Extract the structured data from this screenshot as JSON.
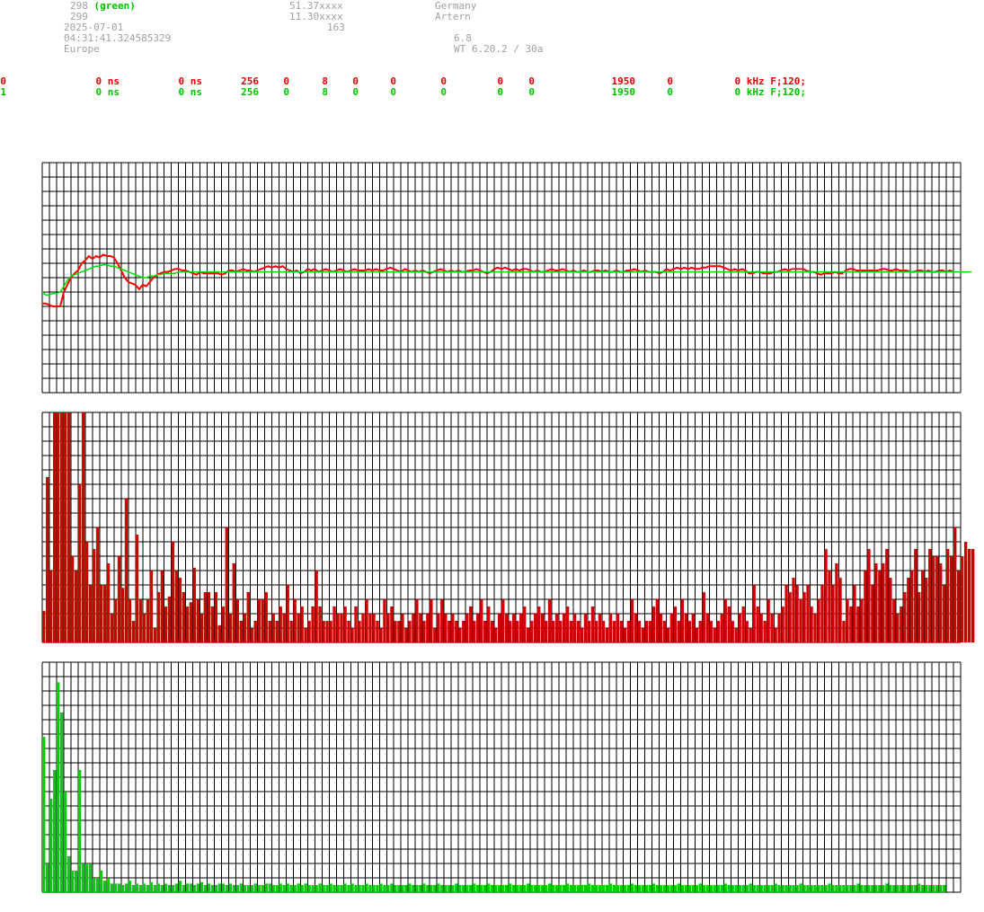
{
  "header": {
    "col1": {
      "line1_num": "298",
      "line1_tag": "(green)",
      "line2": "299",
      "date": "2025-07-01",
      "time": "04:31:41.324585329",
      "region": "Europe"
    },
    "col2": {
      "lat": "51.37xxxx",
      "lon": "11.30xxxx",
      "alt": "163"
    },
    "col3": {
      "country": "Germany",
      "city": "Artern",
      "value": "6.8",
      "version": "WT 6.20.2 / 30a"
    }
  },
  "status_rows": [
    {
      "color": "#e00000",
      "cells": [
        "0",
        "0 ns",
        "0 ns",
        "256",
        "0",
        "8",
        "0",
        "0",
        "0",
        "0",
        "0",
        "1950",
        "0",
        "0 kHz F;120;"
      ]
    },
    {
      "color": "#00c000",
      "cells": [
        "1",
        "0 ns",
        "0 ns",
        "256",
        "0",
        "8",
        "0",
        "0",
        "0",
        "0",
        "0",
        "1950",
        "0",
        "0 kHz F;120;"
      ]
    }
  ],
  "chart_data": [
    {
      "type": "line",
      "title": "",
      "grid": true,
      "ylim": [
        -8,
        8
      ],
      "x_count": 256,
      "series": [
        {
          "color": "#ff0000",
          "values": [
            -1.8,
            -1.8,
            -1.9,
            -2.0,
            -2.0,
            -2.0,
            -1.0,
            -0.5,
            0.0,
            0.3,
            0.5,
            1.0,
            1.2,
            1.5,
            1.3,
            1.5,
            1.4,
            1.6,
            1.5,
            1.5,
            1.4,
            1.0,
            0.5,
            0.0,
            -0.3,
            -0.4,
            -0.5,
            -0.8,
            -0.5,
            -0.6,
            -0.3,
            0.0,
            0.2,
            0.3,
            0.4,
            0.4,
            0.5,
            0.6,
            0.6,
            0.5,
            0.5,
            0.4,
            0.3,
            0.2,
            0.4,
            0.3,
            0.3,
            0.3,
            0.3,
            0.3,
            0.2,
            0.3,
            0.5,
            0.5,
            0.4,
            0.5,
            0.6,
            0.5,
            0.5,
            0.4,
            0.5,
            0.6,
            0.7,
            0.8,
            0.7,
            0.8,
            0.7,
            0.8,
            0.6,
            0.5,
            0.4,
            0.5,
            0.3,
            0.4,
            0.6,
            0.5,
            0.6,
            0.4,
            0.5,
            0.6,
            0.5,
            0.4,
            0.5,
            0.6,
            0.5,
            0.4,
            0.5,
            0.6,
            0.5,
            0.5,
            0.5,
            0.6,
            0.5,
            0.6,
            0.5,
            0.5,
            0.6,
            0.7,
            0.6,
            0.5,
            0.4,
            0.6,
            0.5,
            0.4,
            0.5,
            0.4,
            0.5,
            0.4,
            0.3,
            0.4,
            0.5,
            0.6,
            0.5,
            0.4,
            0.5,
            0.4,
            0.5,
            0.4,
            0.4,
            0.5,
            0.5,
            0.6,
            0.5,
            0.4,
            0.3,
            0.4,
            0.6,
            0.7,
            0.6,
            0.7,
            0.6,
            0.5,
            0.6,
            0.5,
            0.6,
            0.6,
            0.5,
            0.4,
            0.5,
            0.4,
            0.4,
            0.5,
            0.6,
            0.5,
            0.5,
            0.6,
            0.5,
            0.4,
            0.5,
            0.4,
            0.4,
            0.5,
            0.4,
            0.4,
            0.5,
            0.5,
            0.4,
            0.5,
            0.4,
            0.4,
            0.5,
            0.4,
            0.4,
            0.5,
            0.5,
            0.6,
            0.5,
            0.4,
            0.5,
            0.4,
            0.4,
            0.4,
            0.3,
            0.4,
            0.6,
            0.5,
            0.6,
            0.7,
            0.6,
            0.7,
            0.6,
            0.7,
            0.6,
            0.6,
            0.7,
            0.7,
            0.8,
            0.8,
            0.8,
            0.8,
            0.7,
            0.6,
            0.5,
            0.6,
            0.5,
            0.6,
            0.5,
            0.3,
            0.3,
            0.4,
            0.4,
            0.3,
            0.3,
            0.3,
            0.4,
            0.4,
            0.5,
            0.6,
            0.5,
            0.6,
            0.6,
            0.6,
            0.6,
            0.5,
            0.4,
            0.4,
            0.3,
            0.2,
            0.3,
            0.3,
            0.3,
            0.4,
            0.3,
            0.3,
            0.5,
            0.6,
            0.6,
            0.5,
            0.5,
            0.5,
            0.5,
            0.5,
            0.5,
            0.5,
            0.6,
            0.6,
            0.5,
            0.5,
            0.6,
            0.5,
            0.5,
            0.5,
            0.4,
            0.4,
            0.5,
            0.5,
            0.4,
            0.5,
            0.4,
            0.4,
            0.5,
            0.5,
            0.4,
            0.5,
            0.4
          ]
        },
        {
          "color": "#00dd00",
          "values": [
            -1.0,
            -1.2,
            -1.2,
            -1.1,
            -1.1,
            -1.0,
            -0.6,
            -0.2,
            0.1,
            0.2,
            0.3,
            0.4,
            0.5,
            0.6,
            0.7,
            0.8,
            0.8,
            0.9,
            0.9,
            0.8,
            0.8,
            0.7,
            0.6,
            0.5,
            0.4,
            0.3,
            0.2,
            0.1,
            0.0,
            0.0,
            0.1,
            0.1,
            0.2,
            0.2,
            0.3,
            0.3,
            0.3,
            0.3,
            0.4,
            0.4,
            0.4,
            0.4,
            0.4,
            0.4,
            0.4,
            0.4,
            0.4,
            0.4,
            0.4,
            0.4,
            0.4,
            0.4,
            0.4,
            0.4,
            0.4,
            0.4,
            0.4,
            0.4,
            0.4,
            0.4,
            0.4,
            0.4,
            0.4,
            0.4,
            0.4,
            0.4,
            0.4,
            0.4,
            0.4,
            0.4,
            0.4,
            0.4,
            0.4,
            0.4,
            0.4,
            0.4,
            0.4,
            0.4,
            0.4,
            0.4,
            0.4,
            0.4,
            0.4,
            0.4,
            0.4,
            0.4,
            0.4,
            0.4,
            0.4,
            0.4,
            0.4,
            0.4,
            0.4,
            0.4,
            0.4,
            0.4,
            0.4,
            0.4,
            0.4,
            0.4,
            0.4,
            0.4,
            0.4,
            0.4,
            0.4,
            0.4,
            0.4,
            0.4,
            0.4,
            0.4,
            0.4,
            0.4,
            0.4,
            0.4,
            0.4,
            0.4,
            0.4,
            0.4,
            0.4,
            0.4,
            0.4,
            0.4,
            0.4,
            0.4,
            0.4,
            0.4,
            0.4,
            0.4,
            0.4,
            0.4,
            0.4,
            0.4,
            0.4,
            0.4,
            0.4,
            0.4,
            0.4,
            0.4,
            0.4,
            0.4,
            0.4,
            0.4,
            0.4,
            0.4,
            0.4,
            0.4,
            0.4,
            0.4,
            0.4,
            0.4,
            0.4,
            0.4,
            0.4,
            0.4,
            0.4,
            0.4,
            0.4,
            0.4,
            0.4,
            0.4,
            0.4,
            0.4,
            0.4,
            0.4,
            0.4,
            0.4,
            0.4,
            0.4,
            0.4,
            0.4,
            0.4,
            0.4,
            0.4,
            0.4,
            0.4,
            0.4,
            0.4,
            0.4,
            0.4,
            0.4,
            0.4,
            0.4,
            0.4,
            0.4,
            0.4,
            0.4,
            0.4,
            0.4,
            0.4,
            0.4,
            0.4,
            0.4,
            0.4,
            0.4,
            0.4,
            0.4,
            0.4,
            0.4,
            0.4,
            0.4,
            0.4,
            0.4,
            0.4,
            0.4,
            0.4,
            0.4,
            0.4,
            0.4,
            0.4,
            0.4,
            0.4,
            0.4,
            0.4,
            0.4,
            0.4,
            0.4,
            0.4,
            0.4,
            0.4,
            0.4,
            0.4,
            0.4,
            0.4,
            0.4,
            0.4,
            0.4,
            0.4,
            0.4,
            0.4,
            0.4,
            0.4,
            0.4,
            0.4,
            0.4,
            0.4,
            0.4,
            0.4,
            0.4,
            0.4,
            0.4,
            0.4,
            0.4,
            0.4,
            0.4,
            0.4,
            0.4,
            0.4,
            0.4,
            0.4,
            0.4,
            0.4,
            0.4,
            0.4,
            0.4,
            0.4,
            0.4,
            0.4,
            0.4,
            0.4,
            0.4
          ]
        }
      ]
    },
    {
      "type": "bar",
      "title": "",
      "grid": true,
      "ylim": [
        0,
        16
      ],
      "color": "#d00000",
      "values": [
        2.2,
        11.5,
        5.0,
        16.0,
        16.0,
        16.0,
        16.0,
        16.0,
        6.0,
        5.0,
        11.0,
        16.0,
        7.0,
        4.0,
        6.5,
        8.0,
        4.0,
        4.0,
        5.5,
        2.0,
        3.0,
        6.0,
        3.8,
        10.0,
        3.0,
        1.5,
        7.5,
        3.0,
        2.0,
        3.0,
        5.0,
        1.0,
        3.5,
        5.0,
        2.5,
        3.2,
        7.0,
        5.0,
        4.5,
        3.5,
        2.5,
        2.8,
        5.2,
        3.0,
        2.0,
        3.5,
        3.5,
        2.5,
        3.5,
        1.2,
        2.5,
        8.0,
        2.0,
        5.5,
        3.0,
        1.5,
        2.0,
        3.5,
        1.0,
        1.5,
        3.0,
        3.0,
        3.5,
        1.5,
        2.0,
        1.5,
        2.5,
        2.0,
        4.0,
        1.5,
        3.0,
        2.0,
        2.5,
        1.0,
        1.5,
        2.5,
        5.0,
        2.5,
        1.5,
        1.5,
        1.5,
        2.5,
        2.0,
        2.0,
        2.5,
        1.5,
        1.0,
        2.5,
        1.5,
        2.0,
        3.0,
        2.0,
        2.0,
        1.5,
        1.0,
        3.0,
        2.0,
        2.5,
        1.5,
        1.5,
        2.0,
        1.0,
        1.5,
        2.0,
        3.0,
        2.0,
        1.5,
        2.0,
        3.0,
        1.0,
        2.0,
        3.0,
        2.0,
        1.5,
        2.0,
        1.5,
        1.0,
        1.5,
        2.0,
        2.5,
        1.5,
        2.0,
        3.0,
        1.5,
        2.5,
        1.5,
        1.0,
        2.0,
        3.0,
        2.0,
        1.5,
        2.0,
        1.5,
        2.0,
        2.5,
        1.0,
        1.5,
        2.0,
        2.5,
        2.0,
        1.5,
        3.0,
        1.5,
        2.0,
        1.5,
        2.0,
        2.5,
        1.5,
        2.0,
        1.5,
        1.0,
        2.0,
        1.5,
        2.5,
        1.5,
        2.0,
        1.5,
        1.0,
        2.0,
        1.5,
        2.0,
        1.5,
        1.0,
        1.5,
        3.0,
        2.0,
        1.5,
        1.0,
        1.5,
        1.5,
        2.5,
        3.0,
        2.0,
        1.5,
        1.0,
        2.0,
        2.5,
        1.5,
        3.0,
        2.0,
        1.5,
        2.0,
        1.0,
        1.5,
        3.5,
        2.0,
        1.5,
        1.0,
        1.5,
        2.0,
        3.0,
        2.5,
        1.5,
        1.0,
        2.0,
        2.5,
        1.5,
        1.0,
        4.0,
        2.5,
        2.0,
        1.5,
        3.0,
        2.0,
        1.0,
        2.0,
        2.5,
        4.0,
        3.5,
        4.5,
        4.0,
        3.0,
        3.5,
        4.0,
        2.5,
        2.0,
        3.0,
        4.0,
        6.5,
        5.0,
        4.0,
        5.5,
        4.5,
        1.5,
        3.0,
        2.5,
        4.0,
        2.5,
        3.0,
        5.0,
        6.5,
        4.0,
        5.5,
        5.0,
        5.5,
        6.5,
        4.5,
        3.0,
        2.0,
        2.5,
        3.5,
        4.5,
        5.0,
        6.5,
        3.5,
        5.0,
        4.5,
        6.5,
        6.0,
        6.0,
        5.5,
        4.0,
        6.5,
        6.0,
        8.0,
        5.0,
        6.0,
        7.0,
        6.5,
        6.5
      ]
    },
    {
      "type": "bar",
      "title": "",
      "grid": true,
      "ylim": [
        0,
        16
      ],
      "color": "#00cc00",
      "values": [
        10.8,
        2.0,
        6.5,
        8.5,
        14.6,
        12.5,
        7.0,
        2.5,
        1.5,
        1.5,
        8.5,
        2.0,
        2.0,
        2.0,
        1.0,
        1.0,
        1.5,
        0.8,
        1.0,
        0.6,
        0.6,
        0.6,
        0.5,
        0.6,
        0.8,
        0.5,
        0.6,
        0.5,
        0.6,
        0.5,
        0.7,
        0.5,
        0.6,
        0.5,
        0.6,
        0.5,
        0.5,
        0.6,
        0.8,
        0.5,
        0.6,
        0.6,
        0.5,
        0.6,
        0.7,
        0.5,
        0.6,
        0.5,
        0.5,
        0.6,
        0.6,
        0.5,
        0.6,
        0.5,
        0.5,
        0.6,
        0.5,
        0.5,
        0.5,
        0.6,
        0.5,
        0.5,
        0.6,
        0.6,
        0.5,
        0.5,
        0.6,
        0.5,
        0.6,
        0.5,
        0.5,
        0.6,
        0.5,
        0.6,
        0.5,
        0.5,
        0.5,
        0.6,
        0.5,
        0.5,
        0.6,
        0.5,
        0.5,
        0.5,
        0.6,
        0.5,
        0.6,
        0.5,
        0.5,
        0.5,
        0.6,
        0.5,
        0.5,
        0.5,
        0.6,
        0.5,
        0.5,
        0.6,
        0.5,
        0.5,
        0.5,
        0.5,
        0.6,
        0.5,
        0.5,
        0.5,
        0.6,
        0.5,
        0.5,
        0.5,
        0.6,
        0.5,
        0.5,
        0.5,
        0.5,
        0.6,
        0.5,
        0.5,
        0.5,
        0.5,
        0.6,
        0.5,
        0.5,
        0.5,
        0.6,
        0.5,
        0.5,
        0.5,
        0.5,
        0.5,
        0.6,
        0.5,
        0.5,
        0.5,
        0.5,
        0.6,
        0.5,
        0.5,
        0.5,
        0.5,
        0.5,
        0.6,
        0.5,
        0.5,
        0.5,
        0.5,
        0.6,
        0.5,
        0.5,
        0.5,
        0.5,
        0.5,
        0.6,
        0.5,
        0.5,
        0.5,
        0.5,
        0.5,
        0.6,
        0.5,
        0.5,
        0.5,
        0.5,
        0.5,
        0.6,
        0.5,
        0.5,
        0.5,
        0.5,
        0.5,
        0.6,
        0.5,
        0.5,
        0.5,
        0.5,
        0.5,
        0.5,
        0.6,
        0.5,
        0.5,
        0.5,
        0.5,
        0.5,
        0.6,
        0.5,
        0.5,
        0.5,
        0.5,
        0.5,
        0.5,
        0.6,
        0.5,
        0.5,
        0.5,
        0.5,
        0.5,
        0.5,
        0.6,
        0.5,
        0.5,
        0.5,
        0.5,
        0.5,
        0.5,
        0.6,
        0.5,
        0.5,
        0.5,
        0.5,
        0.5,
        0.5,
        0.6,
        0.5,
        0.5,
        0.5,
        0.5,
        0.5,
        0.5,
        0.5,
        0.6,
        0.5,
        0.5,
        0.5,
        0.5,
        0.5,
        0.5,
        0.5,
        0.6,
        0.5,
        0.5,
        0.5,
        0.5,
        0.5,
        0.5,
        0.5,
        0.6,
        0.5,
        0.5,
        0.5,
        0.5,
        0.5,
        0.5,
        0.5,
        0.5,
        0.6,
        0.5,
        0.5,
        0.5,
        0.5,
        0.5,
        0.5,
        0.5
      ]
    }
  ]
}
